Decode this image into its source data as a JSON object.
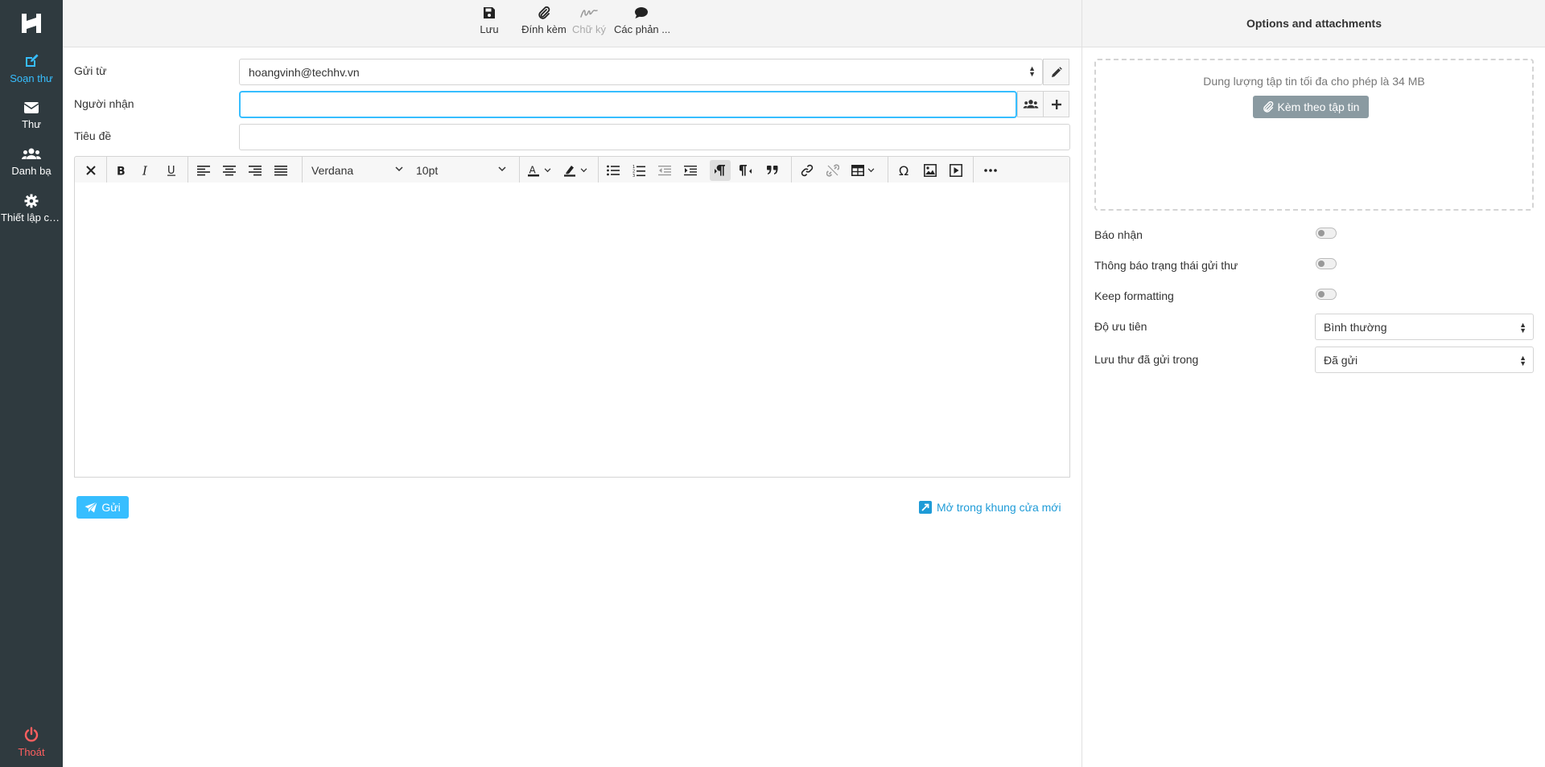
{
  "sidebar": {
    "logo": "H",
    "items": [
      {
        "label": "Soạn thư",
        "icon": "compose-icon",
        "active": true
      },
      {
        "label": "Thư",
        "icon": "envelope-icon"
      },
      {
        "label": "Danh bạ",
        "icon": "contacts-icon"
      },
      {
        "label": "Thiết lập cấ...",
        "icon": "gear-icon"
      }
    ],
    "logout": {
      "label": "Thoát",
      "icon": "power-icon"
    }
  },
  "toolbar": {
    "save": "Lưu",
    "attach": "Đính kèm",
    "signature": "Chữ ký",
    "responses": "Các phản ..."
  },
  "compose": {
    "from_label": "Gửi từ",
    "from_value": "hoangvinh@techhv.vn",
    "to_label": "Người nhận",
    "to_value": "",
    "subject_label": "Tiêu đề",
    "subject_value": ""
  },
  "editor": {
    "font_family": "Verdana",
    "font_size": "10pt",
    "body": ""
  },
  "actions": {
    "send": "Gửi",
    "open_new_window": "Mở trong khung cửa mới"
  },
  "panel": {
    "title": "Options and attachments",
    "max_size_text": "Dung lượng tập tin tối đa cho phép là 34 MB",
    "attach_button": "Kèm theo tập tin",
    "options": [
      {
        "label": "Báo nhận",
        "enabled": false
      },
      {
        "label": "Thông báo trạng thái gửi thư",
        "enabled": false
      },
      {
        "label": "Keep formatting",
        "enabled": false
      }
    ],
    "priority_label": "Độ ưu tiên",
    "priority_value": "Bình thường",
    "save_sent_label": "Lưu thư đã gửi trong",
    "save_sent_value": "Đã gửi"
  },
  "colors": {
    "sidebar_bg": "#2f3a3f",
    "accent": "#37beff",
    "logout": "#ff5f5f",
    "link": "#1e9bd7"
  }
}
